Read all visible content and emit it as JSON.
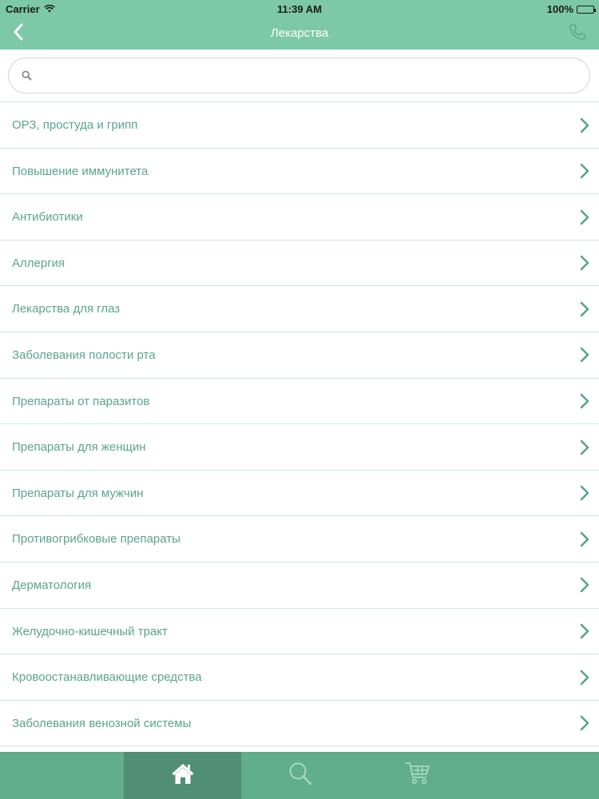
{
  "status_bar": {
    "carrier": "Carrier",
    "time": "11:39 AM",
    "battery": "100%"
  },
  "nav": {
    "title": "Лекарства",
    "back_icon": "chevron-left-icon",
    "action_icon": "phone-icon"
  },
  "search": {
    "icon": "search-icon",
    "value": "",
    "placeholder": ""
  },
  "categories": [
    {
      "label": "ОРЗ, простуда и грипп"
    },
    {
      "label": "Повышение иммунитета"
    },
    {
      "label": "Антибиотики"
    },
    {
      "label": "Аллергия"
    },
    {
      "label": "Лекарства для глаз"
    },
    {
      "label": "Заболевания полости рта"
    },
    {
      "label": "Препараты от паразитов"
    },
    {
      "label": "Препараты для женщин"
    },
    {
      "label": "Препараты для мужчин"
    },
    {
      "label": "Противогрибковые препараты"
    },
    {
      "label": "Дерматология"
    },
    {
      "label": "Желудочно-кишечный тракт"
    },
    {
      "label": "Кровоостанавливающие средства"
    },
    {
      "label": "Заболевания венозной системы"
    }
  ],
  "tab_bar": {
    "tabs": [
      {
        "icon": "home-icon",
        "active": true
      },
      {
        "icon": "search-icon",
        "active": false
      },
      {
        "icon": "cart-icon",
        "active": false
      }
    ]
  },
  "colors": {
    "header": "#7cc8a8",
    "accent_text": "#5aa587",
    "tab_bar": "#61ad8d",
    "tab_active": "#508f75",
    "divider": "#cfe8dc"
  }
}
